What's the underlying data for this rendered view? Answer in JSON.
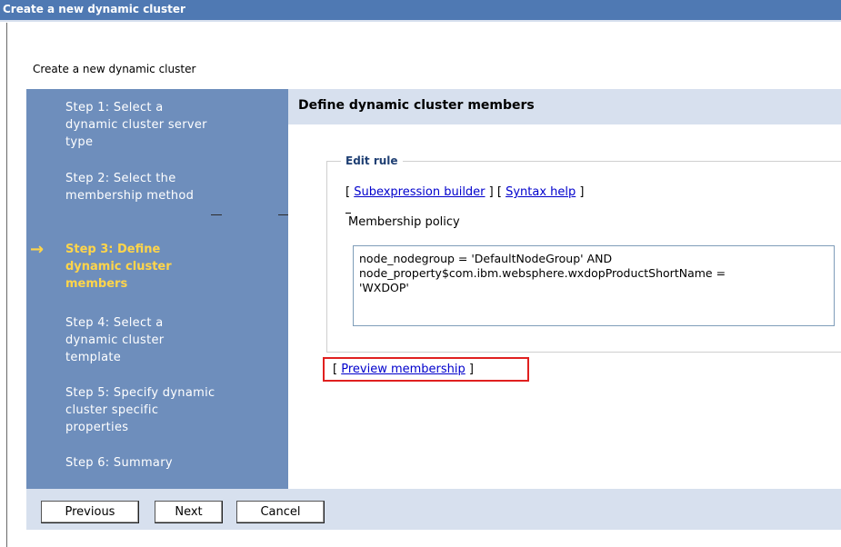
{
  "window": {
    "title": "Create a new dynamic cluster"
  },
  "page": {
    "heading": "Create a new dynamic cluster"
  },
  "steps": [
    {
      "label": "Step 1: Select a dynamic cluster server type"
    },
    {
      "label": "Step 2: Select the membership method"
    },
    {
      "label": "Step 3: Define dynamic cluster members",
      "current": true
    },
    {
      "label": "Step 4: Select a dynamic cluster template"
    },
    {
      "label": "Step 5: Specify dynamic cluster specific properties"
    },
    {
      "label": "Step 6: Summary"
    }
  ],
  "current_step_arrow": "→",
  "main": {
    "header": "Define dynamic cluster members",
    "edit_rule_legend": "Edit rule",
    "bracket_open": "[ ",
    "bracket_mid": " ] [ ",
    "bracket_close": " ]",
    "subexpression_link": "Subexpression builder",
    "syntax_help_link": "Syntax help",
    "membership_policy_label": "Membership policy",
    "membership_policy_value": "node_nodegroup = 'DefaultNodeGroup' AND\nnode_property$com.ibm.websphere.wxdopProductShortName =\n'WXDOP'",
    "preview_open": "[ ",
    "preview_link": "Preview membership",
    "preview_close": " ]"
  },
  "footer": {
    "previous_label": "Previous",
    "next_label": "Next",
    "cancel_label": "Cancel"
  },
  "colors": {
    "titlebar": "#4f79b3",
    "sidebar": "#6e8ebc",
    "header_band": "#d7e0ee",
    "current_step": "#ffd54a",
    "link": "#0000cc",
    "highlight_box": "#e0201f"
  }
}
